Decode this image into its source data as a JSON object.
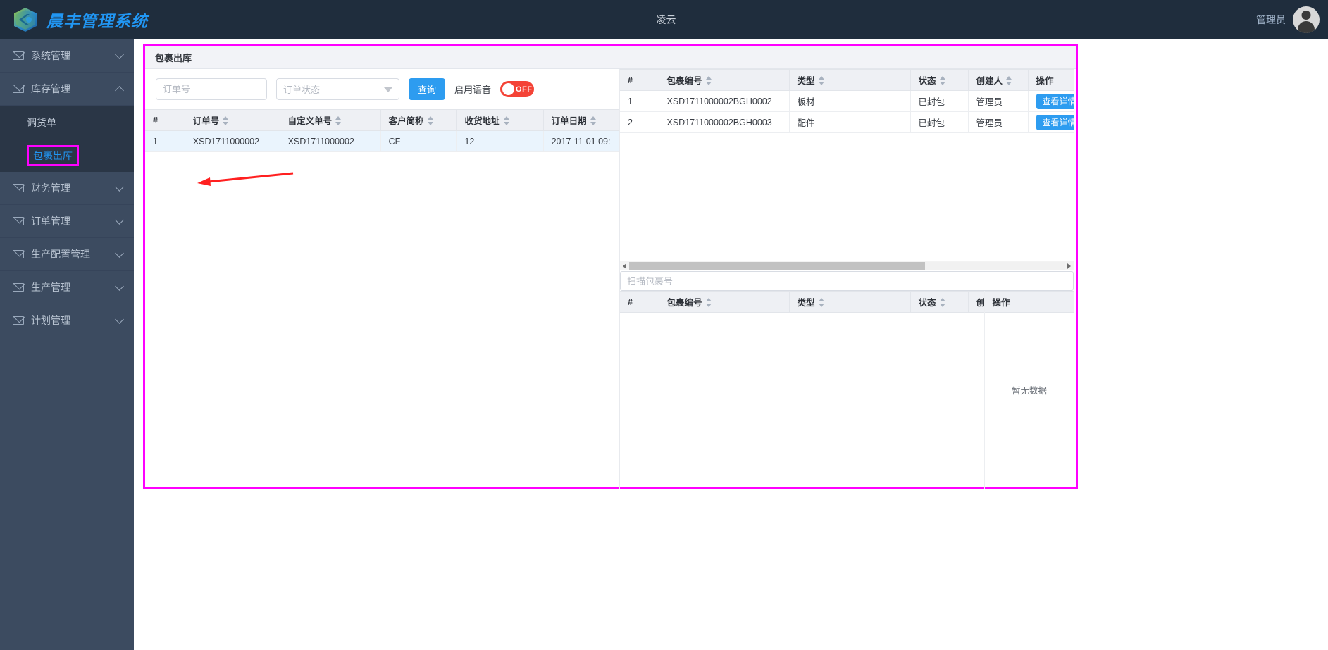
{
  "topbar": {
    "brand_title": "晨丰管理系统",
    "center_title": "凌云",
    "user_name": "管理员",
    "logo_icon": "cube-logo-icon",
    "avatar_icon": "user-avatar-icon"
  },
  "sidebar": {
    "items": [
      {
        "label": "系统管理",
        "icon": "envelope-icon",
        "chevron": "chevron-down-icon",
        "expanded": false
      },
      {
        "label": "库存管理",
        "icon": "envelope-icon",
        "chevron": "chevron-up-icon",
        "expanded": true
      },
      {
        "label": "财务管理",
        "icon": "envelope-icon",
        "chevron": "chevron-down-icon",
        "expanded": false
      },
      {
        "label": "订单管理",
        "icon": "envelope-icon",
        "chevron": "chevron-down-icon",
        "expanded": false
      },
      {
        "label": "生产配置管理",
        "icon": "envelope-icon",
        "chevron": "chevron-down-icon",
        "expanded": false
      },
      {
        "label": "生产管理",
        "icon": "envelope-icon",
        "chevron": "chevron-down-icon",
        "expanded": false
      },
      {
        "label": "计划管理",
        "icon": "envelope-icon",
        "chevron": "chevron-down-icon",
        "expanded": false
      }
    ],
    "submenu": [
      {
        "label": "调货单",
        "active": false
      },
      {
        "label": "包裹出库",
        "active": true
      }
    ]
  },
  "panel": {
    "title": "包裹出库",
    "highlight_color": "#ff00ff",
    "accent_color": "#2d9cf0",
    "toggle_color": "#f44336"
  },
  "toolbar": {
    "order_no_value": "",
    "order_no_placeholder": "订单号",
    "order_status_value": "",
    "order_status_placeholder": "订单状态",
    "search_label": "查询",
    "voice_label": "启用语音",
    "toggle_state": "OFF",
    "caret_icon": "chevron-down-icon"
  },
  "orders_table": {
    "columns": [
      {
        "label": "#",
        "sortable": false
      },
      {
        "label": "订单号",
        "sortable": true
      },
      {
        "label": "自定义单号",
        "sortable": true
      },
      {
        "label": "客户简称",
        "sortable": true
      },
      {
        "label": "收货地址",
        "sortable": true
      },
      {
        "label": "订单日期",
        "sortable": true
      }
    ],
    "rows": [
      {
        "index": "1",
        "order_no": "XSD1711000002",
        "custom_no": "XSD1711000002",
        "customer": "CF",
        "address": "12",
        "date": "2017-11-01 09:"
      }
    ]
  },
  "packages_table": {
    "columns": [
      {
        "label": "#",
        "sortable": false
      },
      {
        "label": "包裹编号",
        "sortable": true
      },
      {
        "label": "类型",
        "sortable": true
      },
      {
        "label": "状态",
        "sortable": true
      },
      {
        "label": "创建人",
        "sortable": true
      },
      {
        "label": "操作",
        "sortable": false
      }
    ],
    "rows": [
      {
        "index": "1",
        "package_no": "XSD1711000002BGH0002",
        "type": "板材",
        "status": "已封包",
        "creator": "管理员",
        "action_label": "查看详情"
      },
      {
        "index": "2",
        "package_no": "XSD1711000002BGH0003",
        "type": "配件",
        "status": "已封包",
        "creator": "管理员",
        "action_label": "查看详情"
      }
    ],
    "scrollbar": {
      "left_arrow_icon": "caret-left-icon",
      "right_arrow_icon": "caret-right-icon"
    }
  },
  "scan": {
    "value": "",
    "placeholder": "扫描包裹号"
  },
  "scanned_table": {
    "columns": [
      {
        "label": "#",
        "sortable": false
      },
      {
        "label": "包裹编号",
        "sortable": true
      },
      {
        "label": "类型",
        "sortable": true
      },
      {
        "label": "状态",
        "sortable": true
      },
      {
        "label": "创",
        "sortable": false
      },
      {
        "label": "操作",
        "sortable": false
      }
    ],
    "rows": [],
    "empty_text": "暂无数据"
  }
}
